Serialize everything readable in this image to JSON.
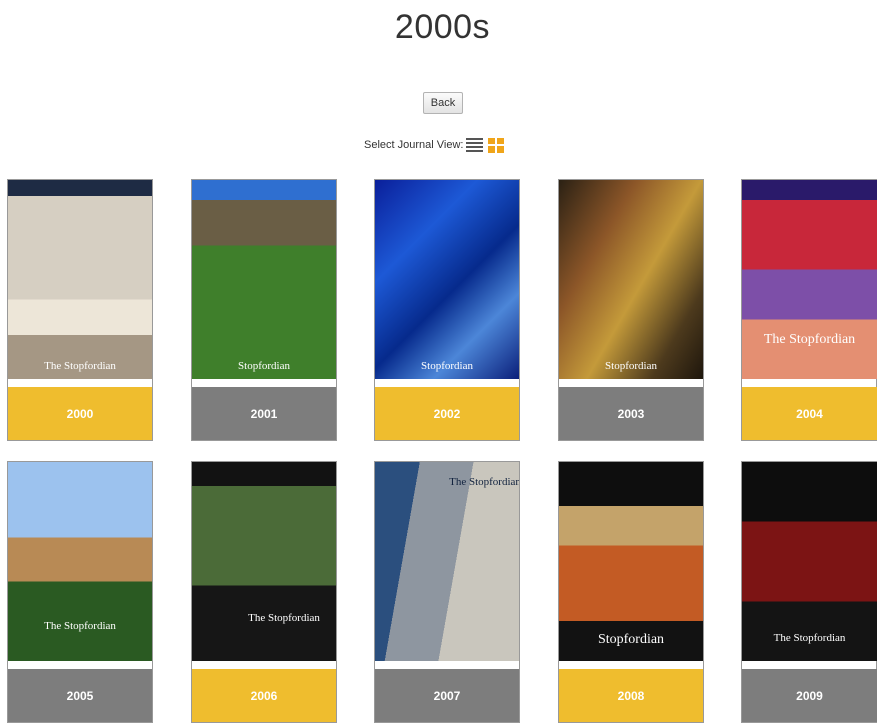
{
  "page": {
    "title": "2000s"
  },
  "back_label": "Back",
  "view_selector": {
    "label": "Select Journal View:",
    "list_icon": "list-view-icon",
    "grid_icon": "grid-view-icon"
  },
  "colors": {
    "accent_yellow": "#efbd2e",
    "band_grey": "#7d7d7d"
  },
  "journals": [
    {
      "year": "2000",
      "cover_title": "The Stopfordian",
      "band": "yellow"
    },
    {
      "year": "2001",
      "cover_title": "Stopfordian",
      "band": "grey"
    },
    {
      "year": "2002",
      "cover_title": "Stopfordian",
      "band": "yellow"
    },
    {
      "year": "2003",
      "cover_title": "Stopfordian",
      "band": "grey"
    },
    {
      "year": "2004",
      "cover_title": "The Stopfordian",
      "band": "yellow"
    },
    {
      "year": "2005",
      "cover_title": "The Stopfordian",
      "band": "grey"
    },
    {
      "year": "2006",
      "cover_title": "The Stopfordian",
      "band": "yellow"
    },
    {
      "year": "2007",
      "cover_title": "The Stopfordian",
      "band": "grey"
    },
    {
      "year": "2008",
      "cover_title": "Stopfordian",
      "band": "yellow"
    },
    {
      "year": "2009",
      "cover_title": "The Stopfordian",
      "band": "grey"
    }
  ]
}
